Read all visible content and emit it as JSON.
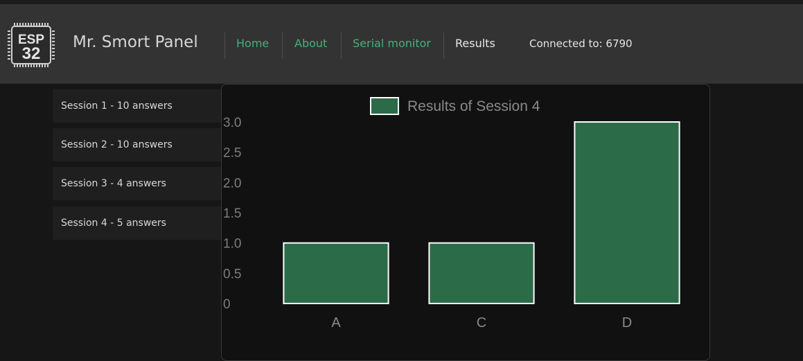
{
  "header": {
    "logo_text_top": "ESP",
    "logo_text_bottom": "32",
    "brand": "Mr. Smort Panel",
    "nav": [
      {
        "label": "Home"
      },
      {
        "label": "About"
      },
      {
        "label": "Serial monitor"
      },
      {
        "label": "Results"
      }
    ],
    "connection": "Connected to: 6790"
  },
  "sidebar": {
    "items": [
      {
        "label": "Session 1 - 10 answers"
      },
      {
        "label": "Session 2 - 10 answers"
      },
      {
        "label": "Session 3 - 4 answers"
      },
      {
        "label": "Session 4 - 5 answers"
      }
    ]
  },
  "colors": {
    "accent": "#48b07a",
    "bar_fill": "#2b6b47",
    "bar_stroke": "#ffffff",
    "header_bg": "#333333",
    "page_bg": "#161616"
  },
  "chart_data": {
    "type": "bar",
    "legend": "Results of Session 4",
    "categories": [
      "A",
      "C",
      "D"
    ],
    "values": [
      1,
      1,
      3
    ],
    "ylim": [
      0,
      3
    ],
    "yticks": [
      "0",
      "0.5",
      "1.0",
      "1.5",
      "2.0",
      "2.5",
      "3.0"
    ],
    "grid": false
  }
}
